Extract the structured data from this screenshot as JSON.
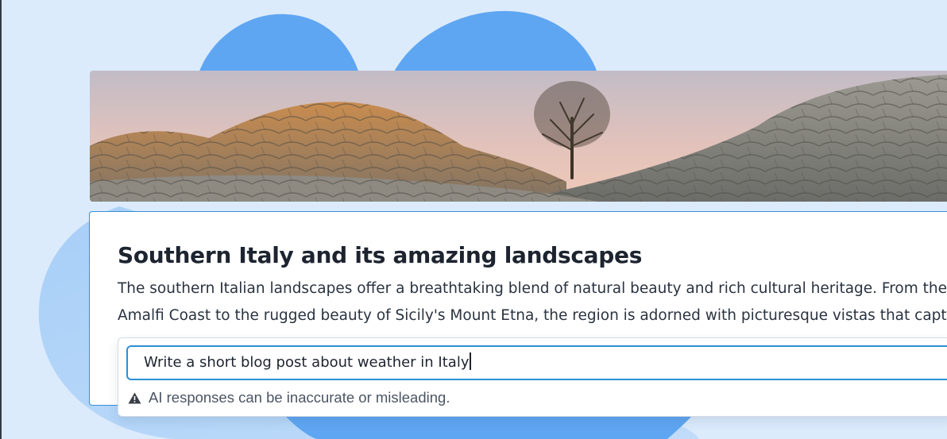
{
  "colors": {
    "page_background": "#dcebfc",
    "blob_blue": "#5fa6f2",
    "accent_border": "#2d8fd5",
    "title_text": "#1d2430",
    "muted_text": "#4b5563"
  },
  "banner": {
    "image_description_icon": "desert-rock-landscape-image"
  },
  "article": {
    "title": "Southern Italy and its amazing landscapes",
    "body_lines": [
      "The southern Italian landscapes offer a breathtaking blend of natural beauty and rich cultural heritage. From the",
      "Amalfi Coast to the rugged beauty of Sicily's Mount Etna, the region is adorned with picturesque vistas that captiv"
    ]
  },
  "ai_assistant": {
    "prompt_value": "Write a short blog post about weather in Italy",
    "disclaimer": "AI responses can be inaccurate or misleading.",
    "disclaimer_icon": "warning-triangle-icon"
  }
}
